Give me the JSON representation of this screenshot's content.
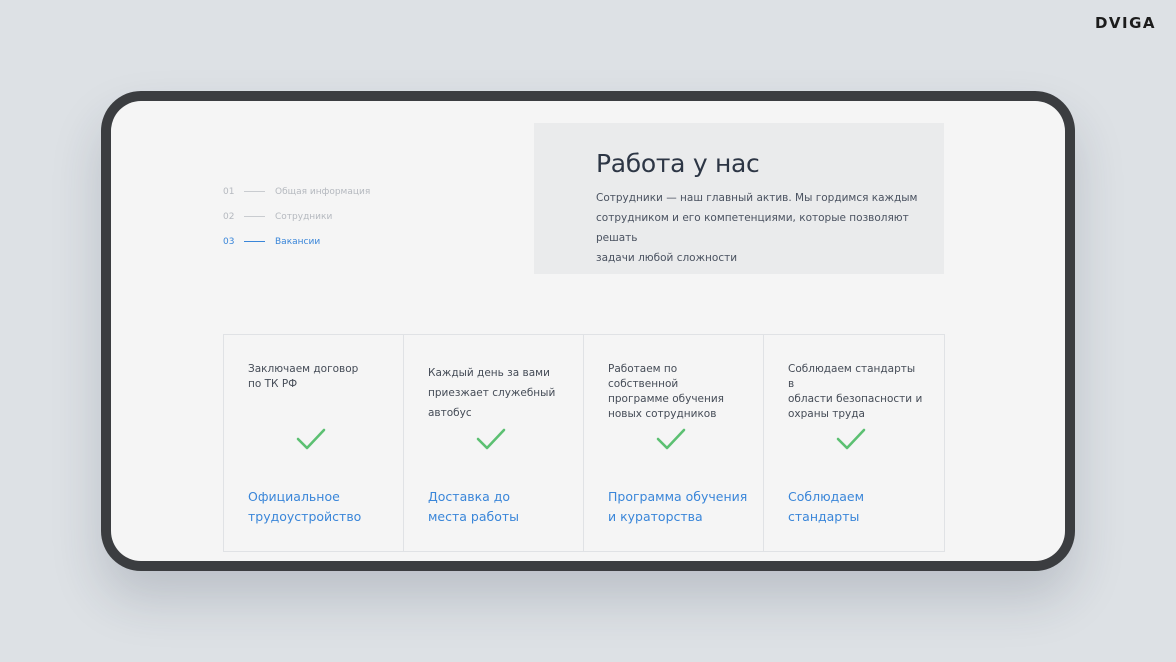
{
  "brand": {
    "logo_text": "DVIGA"
  },
  "nav": {
    "items": [
      {
        "num": "01",
        "label": "Общая информация"
      },
      {
        "num": "02",
        "label": "Сотрудники"
      },
      {
        "num": "03",
        "label": "Вакансии"
      }
    ],
    "active_index": 2
  },
  "hero": {
    "title": "Работа у нас",
    "lines": [
      "Сотрудники — наш главный актив. Мы гордимся каждым",
      "сотрудником и его компетенциями, которые позволяют решать",
      "задачи любой сложности"
    ]
  },
  "cards": [
    {
      "desc_lines": [
        "Заключаем договор",
        "по ТК РФ"
      ],
      "title_lines": [
        "Официальное",
        "трудоустройство"
      ],
      "icon": "check-icon"
    },
    {
      "desc_lines": [
        "Каждый день за вами",
        "приезжает служебный",
        "автобус"
      ],
      "title_lines": [
        "Доставка до",
        "места работы"
      ],
      "icon": "check-icon"
    },
    {
      "desc_lines": [
        "Работаем по собственной",
        "программе обучения",
        "новых сотрудников"
      ],
      "title_lines": [
        "Программа обучения",
        "и кураторства"
      ],
      "icon": "check-icon"
    },
    {
      "desc_lines": [
        "Соблюдаем стандарты в",
        "области безопасности и",
        "охраны труда"
      ],
      "title_lines": [
        "Соблюдаем",
        "стандарты"
      ],
      "icon": "check-icon"
    }
  ],
  "colors": {
    "accent": "#3a86d9",
    "check": "#5cc072",
    "heading": "#2d3645",
    "background": "#dde1e5",
    "device_frame": "#3b3d40"
  }
}
